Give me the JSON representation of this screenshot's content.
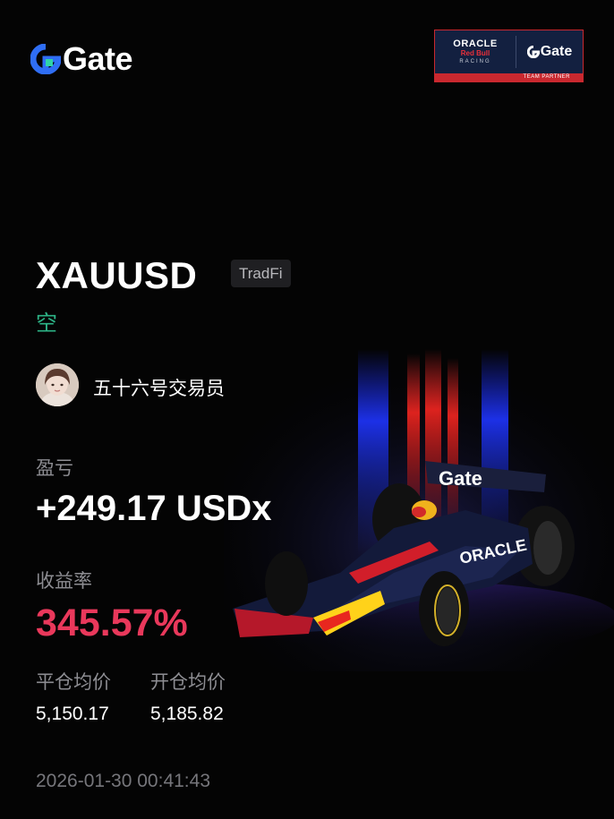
{
  "header": {
    "logo_text": "Gate",
    "partner": {
      "oracle": "ORACLE",
      "redbull": "Red Bull",
      "racing": "RACING",
      "gate": "Gate",
      "strip": "TEAM PARTNER"
    }
  },
  "position": {
    "symbol": "XAUUSD",
    "tag": "TradFi",
    "direction": "空"
  },
  "trader": {
    "name": "五十六号交易员"
  },
  "pnl": {
    "label": "盈亏",
    "value": "+249.17 USDx"
  },
  "return_rate": {
    "label": "收益率",
    "value": "345.57%"
  },
  "prices": {
    "close_label": "平仓均价",
    "close_value": "5,150.17",
    "open_label": "开仓均价",
    "open_value": "5,185.82"
  },
  "timestamp": "2026-01-30 00:41:43",
  "colors": {
    "background": "#040404",
    "short_green": "#2db386",
    "profit_rate_red": "#e9385b",
    "gate_blue": "#2f6ef5",
    "label_gray": "#8d8d92"
  },
  "car_livery": {
    "wing_text": "Gate",
    "sidepod_text": "ORACLE"
  }
}
